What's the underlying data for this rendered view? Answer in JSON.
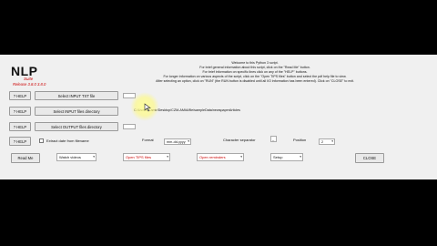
{
  "logo": {
    "title": "NLP",
    "suite": "Suite",
    "release": "Release 3.8.0 3.8.0"
  },
  "intro": {
    "lines": [
      "Welcome to this Python 3 script.",
      "For brief general information about this script, click on the \"Read Me\" button.",
      "For brief information on specific lines click on any of the \"HELP\" buttons.",
      "For longer information on various aspects of the script, click on the \"Open TIPS files\" button and select the pdf help file to view.",
      "After selecting an option, click on \"RUN\" (the RUN button is disabled until all I/O information has been entered). Click on \"CLOSE\" to exit."
    ]
  },
  "rows": {
    "input_txt": {
      "help": "? HELP",
      "button": "Select INPUT TXT file"
    },
    "input_dir": {
      "help": "? HELP",
      "button": "Select INPUT files directory",
      "path": "C:/Users/...amir/Desktop/CZM-AMIA/file/sampleData/newspaperArticles"
    },
    "output_dir": {
      "help": "? HELP",
      "button": "Select OUTPUT files directory"
    },
    "options": {
      "help": "? HELP",
      "extract_label": "Extract date from filename",
      "format_label": "Format",
      "format_value": "mm-dd-yyyy",
      "separator_label": "Character separator",
      "separator_value": "_",
      "position_label": "Position",
      "position_value": "2"
    }
  },
  "bottom": {
    "read_me": "Read Me",
    "watch_videos": "Watch videos",
    "open_tips": "Open TIPS files",
    "open_reminders": "Open reminders",
    "setup": "Setup",
    "close": "CLOSE"
  }
}
